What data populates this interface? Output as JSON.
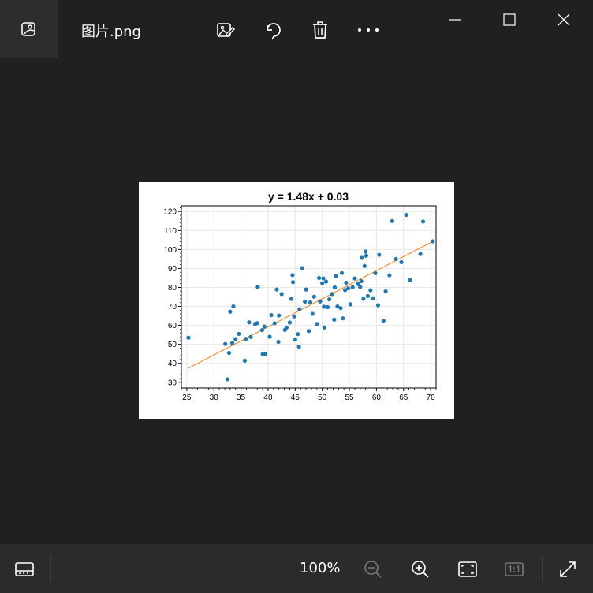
{
  "window": {
    "file_name": "图片.png"
  },
  "toolbar": {
    "buttons": [
      "edit-image",
      "rotate",
      "delete",
      "more"
    ]
  },
  "bottombar": {
    "zoom_level": "100%"
  },
  "colors": {
    "background": "#202020",
    "bottombar": "#2b2b2b",
    "point": "#1f77b4",
    "trendline": "#ff7f0e"
  },
  "chart_data": {
    "type": "scatter",
    "title": "y = 1.48x + 0.03",
    "xlabel": "",
    "ylabel": "",
    "xlim": [
      24,
      71
    ],
    "ylim": [
      27,
      123
    ],
    "xticks": [
      25,
      30,
      35,
      40,
      45,
      50,
      55,
      60,
      65,
      70
    ],
    "yticks": [
      30,
      40,
      50,
      60,
      70,
      80,
      90,
      100,
      110,
      120
    ],
    "grid": true,
    "trendline": {
      "slope": 1.48,
      "intercept": 0.03,
      "x_range": [
        25.3,
        70.4
      ]
    },
    "points": [
      [
        25.3,
        53.5
      ],
      [
        32.5,
        31.6
      ],
      [
        32.1,
        50.2
      ],
      [
        32.8,
        45.5
      ],
      [
        33.0,
        67.2
      ],
      [
        33.6,
        70.0
      ],
      [
        33.4,
        50.7
      ],
      [
        34.0,
        52.8
      ],
      [
        34.6,
        55.5
      ],
      [
        35.7,
        41.4
      ],
      [
        35.9,
        52.9
      ],
      [
        36.5,
        61.6
      ],
      [
        36.8,
        53.9
      ],
      [
        37.6,
        60.7
      ],
      [
        38.0,
        61.2
      ],
      [
        38.1,
        80.2
      ],
      [
        38.9,
        57.5
      ],
      [
        39.3,
        59.4
      ],
      [
        39.0,
        44.9
      ],
      [
        39.5,
        44.9
      ],
      [
        40.3,
        54.0
      ],
      [
        40.6,
        65.4
      ],
      [
        41.2,
        61.1
      ],
      [
        41.6,
        78.9
      ],
      [
        41.9,
        51.3
      ],
      [
        42.0,
        65.2
      ],
      [
        42.5,
        76.5
      ],
      [
        43.1,
        57.6
      ],
      [
        43.4,
        58.8
      ],
      [
        44.0,
        61.5
      ],
      [
        44.3,
        73.9
      ],
      [
        44.5,
        86.5
      ],
      [
        44.6,
        82.8
      ],
      [
        44.8,
        64.7
      ],
      [
        45.0,
        52.5
      ],
      [
        45.5,
        55.4
      ],
      [
        45.7,
        48.8
      ],
      [
        45.8,
        68.5
      ],
      [
        46.3,
        90.2
      ],
      [
        46.8,
        72.5
      ],
      [
        47.0,
        78.9
      ],
      [
        47.5,
        57.0
      ],
      [
        47.8,
        72.1
      ],
      [
        48.2,
        66.1
      ],
      [
        48.5,
        75.1
      ],
      [
        49.0,
        60.7
      ],
      [
        49.4,
        85.0
      ],
      [
        49.6,
        72.6
      ],
      [
        50.0,
        82.2
      ],
      [
        50.2,
        84.8
      ],
      [
        50.4,
        58.9
      ],
      [
        50.3,
        69.8
      ],
      [
        50.7,
        83.1
      ],
      [
        51.0,
        69.6
      ],
      [
        51.3,
        73.7
      ],
      [
        51.8,
        76.5
      ],
      [
        52.2,
        63.0
      ],
      [
        52.3,
        80.0
      ],
      [
        52.5,
        86.0
      ],
      [
        52.8,
        70.0
      ],
      [
        53.4,
        69.1
      ],
      [
        53.6,
        87.6
      ],
      [
        53.8,
        63.7
      ],
      [
        54.2,
        78.6
      ],
      [
        54.4,
        82.5
      ],
      [
        54.8,
        79.5
      ],
      [
        55.2,
        71.1
      ],
      [
        55.6,
        80.1
      ],
      [
        56.0,
        84.7
      ],
      [
        56.6,
        81.8
      ],
      [
        57.0,
        80.3
      ],
      [
        57.2,
        83.3
      ],
      [
        57.3,
        95.6
      ],
      [
        57.6,
        74.0
      ],
      [
        57.8,
        91.3
      ],
      [
        58.0,
        98.9
      ],
      [
        58.1,
        96.7
      ],
      [
        58.4,
        75.5
      ],
      [
        58.9,
        78.5
      ],
      [
        59.4,
        74.3
      ],
      [
        59.8,
        87.5
      ],
      [
        60.3,
        70.6
      ],
      [
        60.5,
        97.2
      ],
      [
        61.3,
        62.5
      ],
      [
        61.7,
        77.9
      ],
      [
        62.4,
        86.4
      ],
      [
        62.9,
        115.0
      ],
      [
        63.6,
        95.0
      ],
      [
        64.6,
        93.3
      ],
      [
        65.5,
        118.2
      ],
      [
        66.2,
        83.9
      ],
      [
        68.1,
        97.6
      ],
      [
        68.6,
        114.7
      ],
      [
        70.4,
        104.3
      ]
    ]
  }
}
